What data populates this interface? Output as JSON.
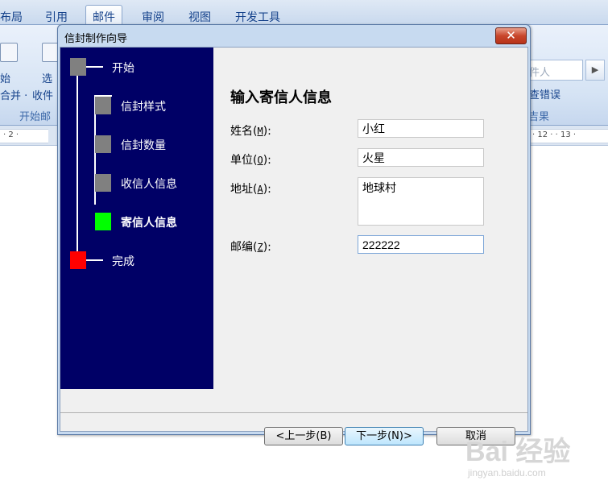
{
  "ribbon": {
    "tabs": [
      "布局",
      "引用",
      "邮件",
      "审阅",
      "视图",
      "开发工具"
    ],
    "active_tab": "邮件",
    "left_labels": [
      "始",
      "选",
      "合并 ·",
      "收件"
    ],
    "group_start": "开始邮",
    "right_labels": [
      "件人",
      "查错误"
    ],
    "group_result": "吉果",
    "ruler_left": "· 2 ·",
    "ruler_right": "· 12 ·  · 13 ·"
  },
  "dialog": {
    "title": "信封制作向导",
    "close_symbol": "✕",
    "steps": [
      {
        "label": "开始",
        "state": "gray"
      },
      {
        "label": "信封样式",
        "state": "gray"
      },
      {
        "label": "信封数量",
        "state": "gray"
      },
      {
        "label": "收信人信息",
        "state": "gray"
      },
      {
        "label": "寄信人信息",
        "state": "current"
      },
      {
        "label": "完成",
        "state": "end"
      }
    ],
    "form_title": "输入寄信人信息",
    "fields": {
      "name": {
        "label": "姓名",
        "key": "M",
        "value": "小红"
      },
      "company": {
        "label": "单位",
        "key": "O",
        "value": "火星"
      },
      "address": {
        "label": "地址",
        "key": "A",
        "value": "地球村"
      },
      "zip": {
        "label": "邮编",
        "key": "Z",
        "value": "222222"
      }
    },
    "buttons": {
      "back": "<上一步(B)",
      "next": "下一步(N)>",
      "cancel": "取消"
    }
  },
  "colors": {
    "nav_bg": "#000066",
    "step_gray": "#808080",
    "step_current": "#00ff00",
    "step_end": "#ff0000",
    "close_button": "#c8462b"
  },
  "watermark": {
    "text": "Bai  经验",
    "url": "jingyan.baidu.com"
  }
}
